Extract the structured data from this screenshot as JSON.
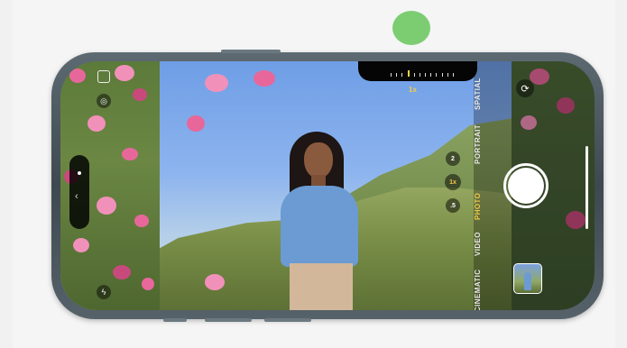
{
  "viewfinder": {
    "zoom_label": "1x"
  },
  "modes": {
    "items": [
      {
        "label": "SPATIAL"
      },
      {
        "label": "PORTRAIT"
      },
      {
        "label": "PHOTO",
        "active": true
      },
      {
        "label": "VIDEO"
      },
      {
        "label": "CINEMATIC"
      }
    ]
  },
  "zoom_buttons": {
    "items": [
      {
        "label": "2"
      },
      {
        "label": "1x",
        "active": true
      },
      {
        "label": ".5"
      }
    ]
  },
  "colors": {
    "accent": "#f2c94c",
    "indicator": "#7ccd72",
    "frame": "#4b565e"
  },
  "icons": {
    "top_left": "aspect-square-icon",
    "live": "live-photo-icon",
    "side_panel": "chevron-left-icon",
    "flash": "flash-icon",
    "flip": "camera-flip-icon"
  }
}
